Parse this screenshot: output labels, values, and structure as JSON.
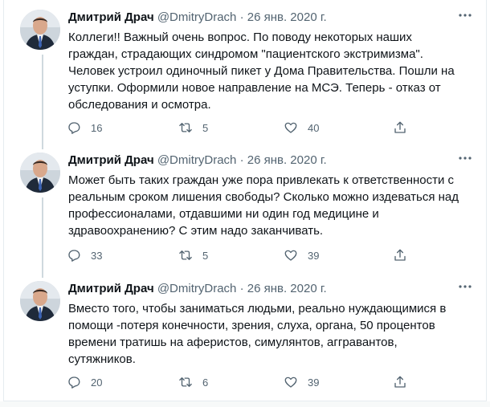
{
  "tweets": [
    {
      "name": "Дмитрий Драч",
      "handle": "@DmitryDrach",
      "dot": "·",
      "date": "26 янв. 2020 г.",
      "lines": [
        "Коллеги!! Важный очень вопрос. По поводу некоторых наших",
        "граждан, страдающих синдромом \"пациентского экстримизма\".",
        "Человек устроил одиночный пикет у Дома Правительства. Пошли на",
        "уступки. Оформили новое направление на МСЭ. Теперь - отказ от",
        "обследования и осмотра."
      ],
      "replies": "16",
      "retweets": "5",
      "likes": "40"
    },
    {
      "name": "Дмитрий Драч",
      "handle": "@DmitryDrach",
      "dot": "·",
      "date": "26 янв. 2020 г.",
      "lines": [
        "Может быть таких граждан уже пора привлекать к ответственности с",
        "реальным сроком лишения свободы? Сколько можно издеваться над",
        "профессионалами, отдавшими ни один год медицине и",
        "здравоохранению? С этим надо заканчивать."
      ],
      "replies": "33",
      "retweets": "5",
      "likes": "39"
    },
    {
      "name": "Дмитрий Драч",
      "handle": "@DmitryDrach",
      "dot": "·",
      "date": "26 янв. 2020 г.",
      "lines": [
        "Вместо того, чтобы заниматься людьми, реально нуждающимися в",
        "помощи -потеря конечности, зрения, слуха, органа, 50 процентов",
        "времени тратишь на аферистов, симулянтов, аггравантов,",
        "сутяжников."
      ],
      "replies": "20",
      "retweets": "6",
      "likes": "39"
    }
  ],
  "icons": {
    "reply": "reply-icon",
    "retweet": "retweet-icon",
    "like": "heart-icon",
    "share": "share-icon",
    "more": "more-icon"
  },
  "colors": {
    "text": "#0f1419",
    "secondary": "#536471",
    "divider": "#e6ecf0",
    "thread_line": "#cfd9de"
  }
}
